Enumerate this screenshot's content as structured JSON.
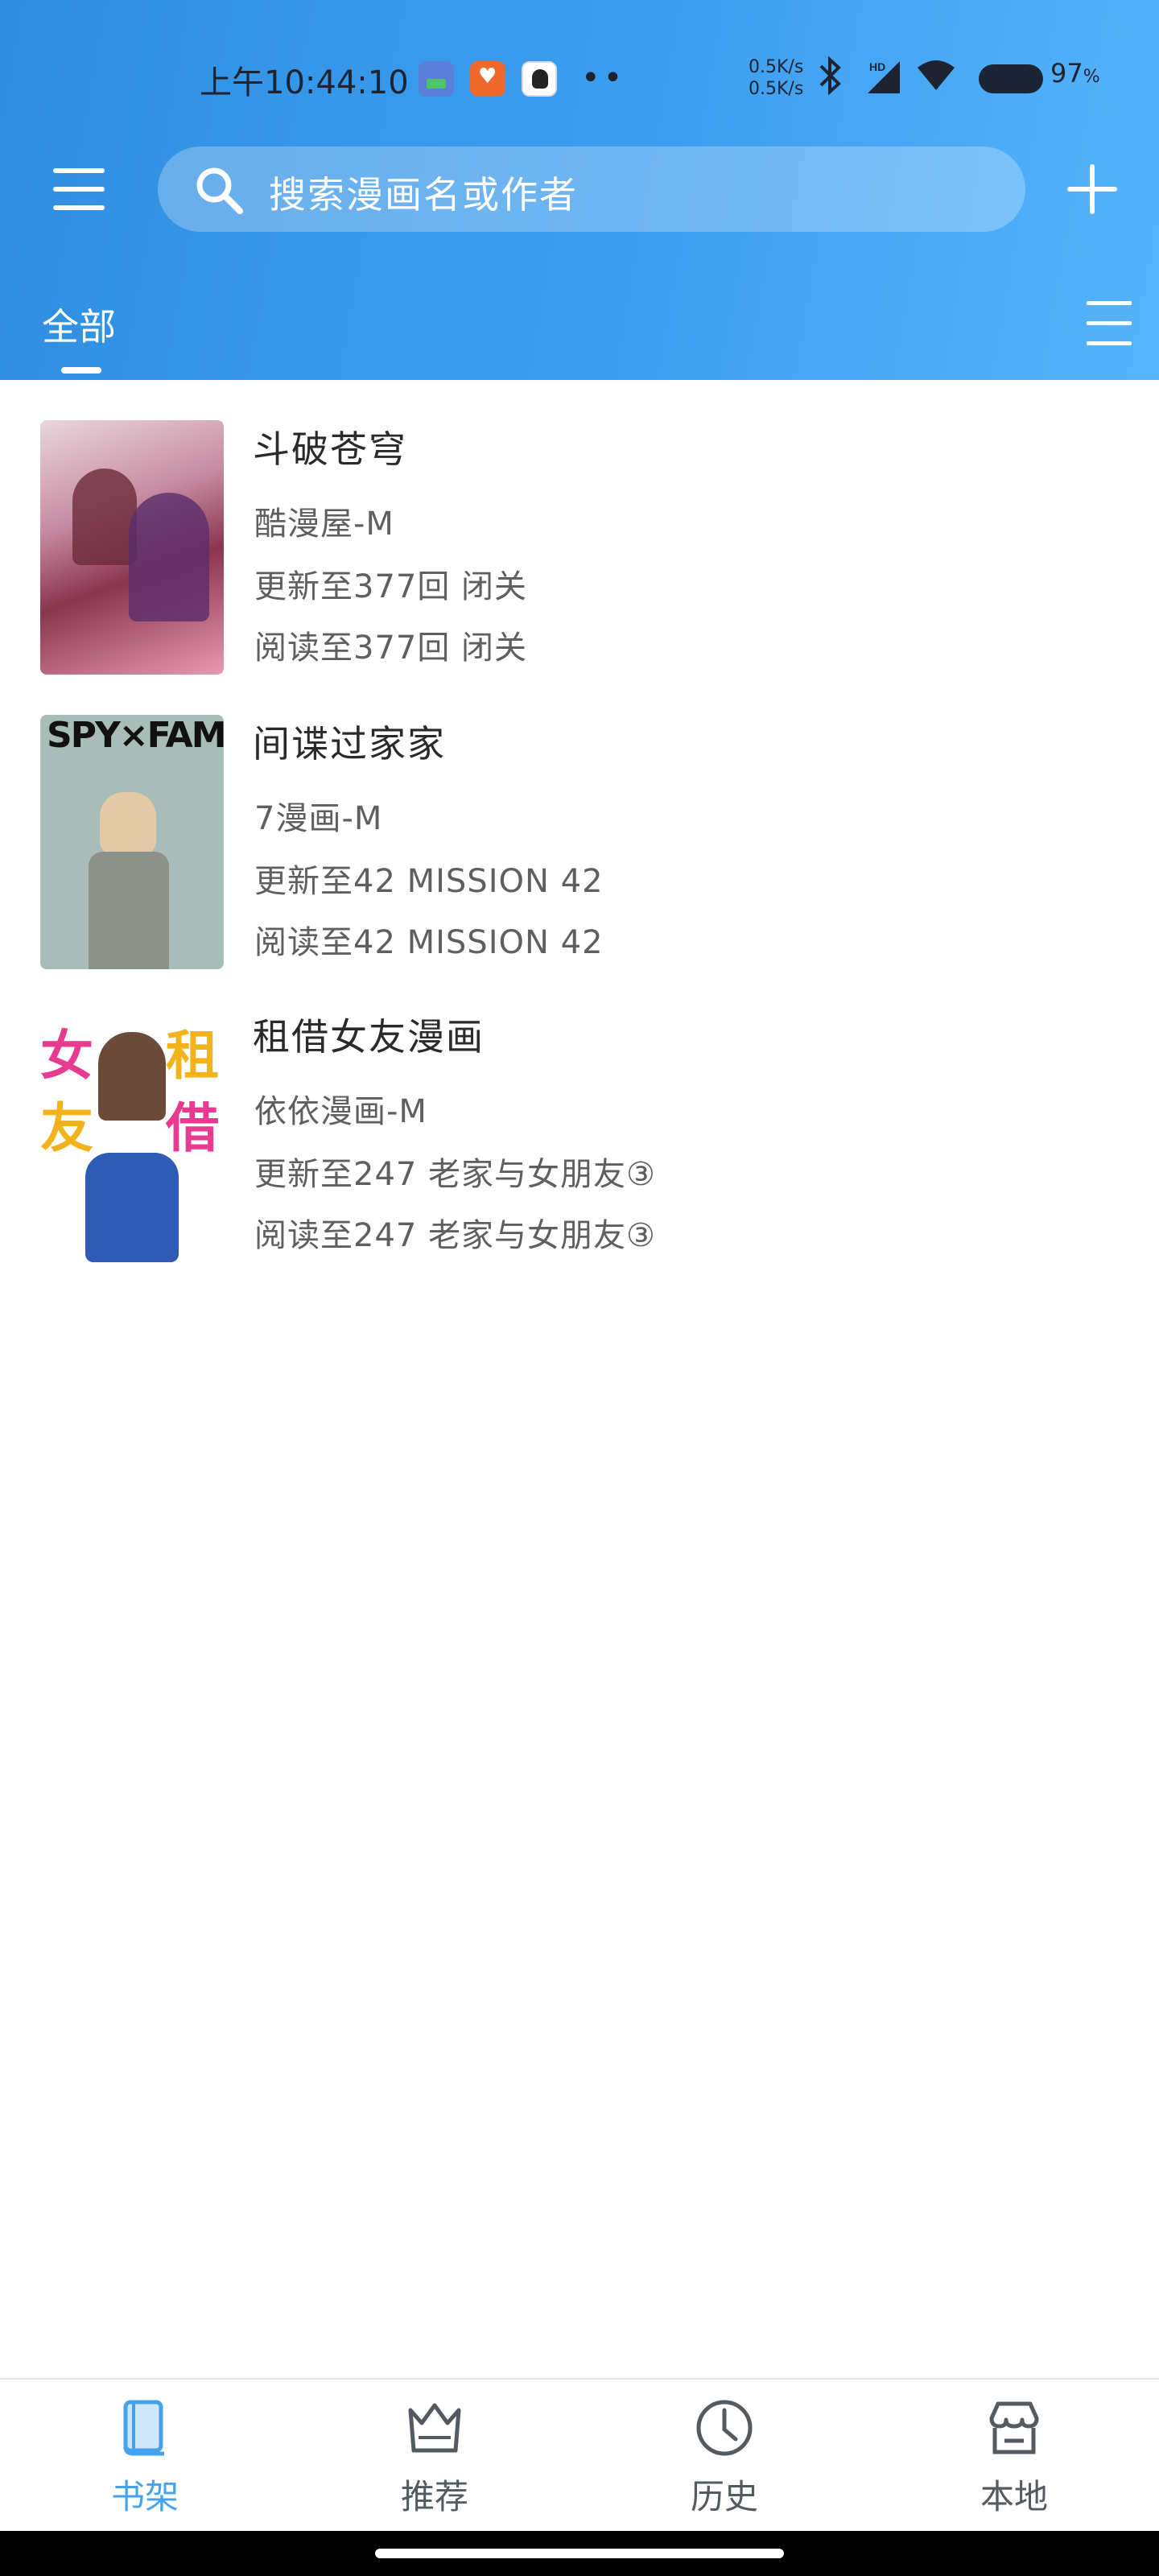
{
  "status_bar": {
    "time": "上午10:44:10",
    "speed_up": "0.5K/s",
    "speed_down": "0.5K/s",
    "battery": "97",
    "battery_unit": "%"
  },
  "toolbar": {
    "search_placeholder": "搜索漫画名或作者"
  },
  "tabs": {
    "current": "全部"
  },
  "comics": [
    {
      "title": "斗破苍穹",
      "source": "酷漫屋-M",
      "updated": "更新至377回 闭关",
      "read": "阅读至377回 闭关"
    },
    {
      "title": "间谍过家家",
      "source": "7漫画-M",
      "updated": "更新至42 MISSION 42",
      "read": "阅读至42 MISSION 42",
      "cover_text": "SPY×FAMILY"
    },
    {
      "title": "租借女友漫画",
      "source": "依依漫画-M",
      "updated": "更新至247 老家与女朋友③",
      "read": "阅读至247 老家与女朋友③",
      "cover_chars": [
        "女",
        "租",
        "友",
        "借"
      ]
    }
  ],
  "bottom_nav": [
    {
      "label": "书架",
      "icon": "book-icon",
      "active": true
    },
    {
      "label": "推荐",
      "icon": "crown-icon",
      "active": false
    },
    {
      "label": "历史",
      "icon": "clock-icon",
      "active": false
    },
    {
      "label": "本地",
      "icon": "store-icon",
      "active": false
    }
  ],
  "colors": {
    "header_start": "#2f8ee0",
    "header_end": "#56b4fb",
    "active_tab": "#45a3ee",
    "text_primary": "#2a2a2a",
    "text_secondary": "#5f5f5f"
  }
}
